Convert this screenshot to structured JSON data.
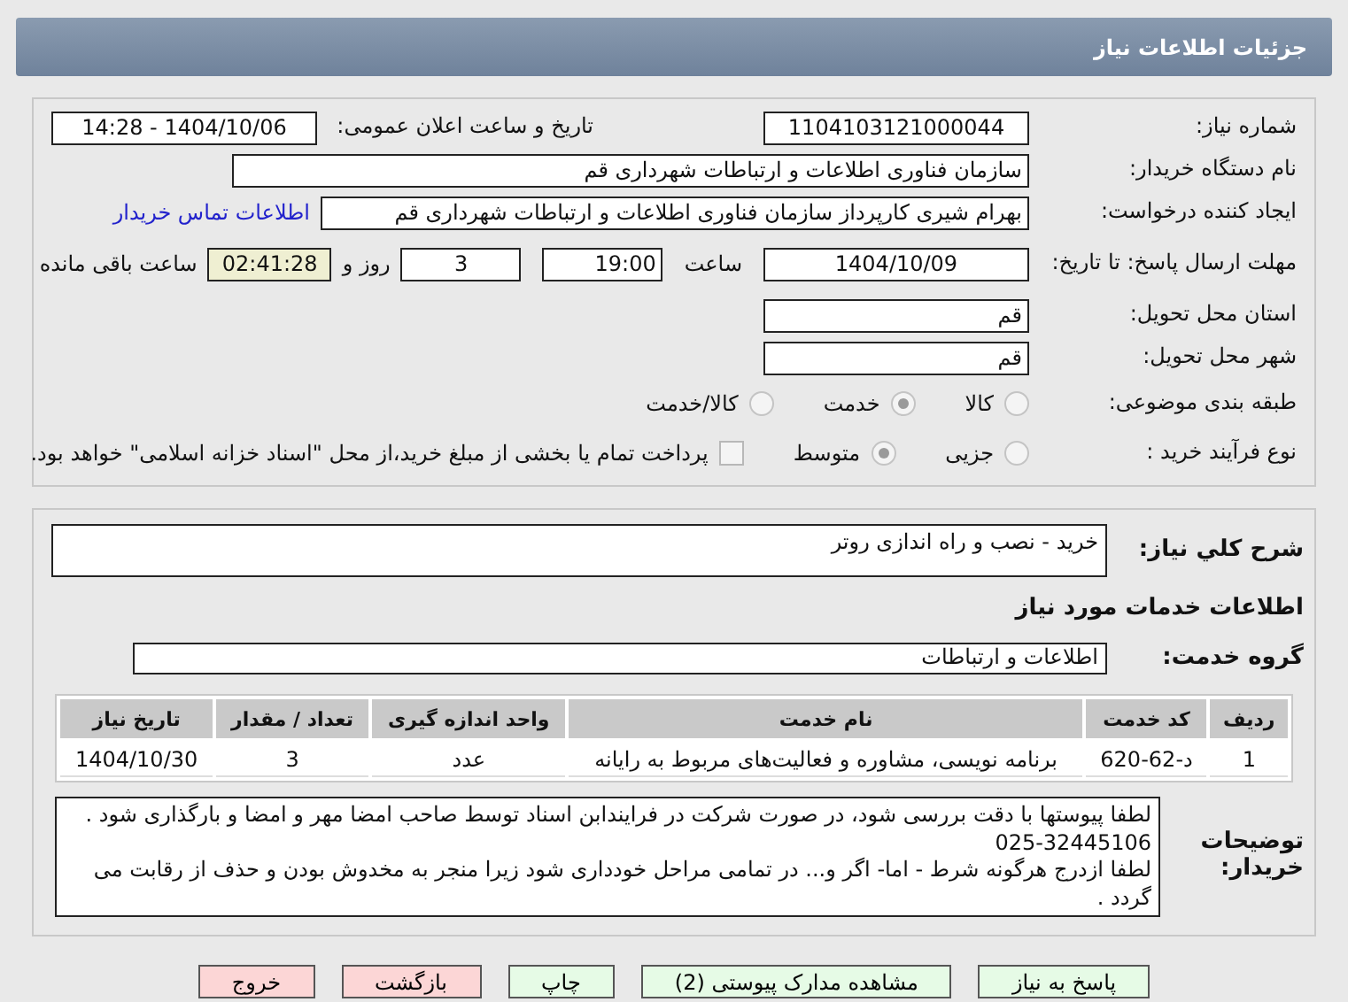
{
  "header": {
    "title": "جزئیات اطلاعات نیاز"
  },
  "need_number": {
    "label": "شماره نیاز:",
    "value": "1104103121000044"
  },
  "announce": {
    "label": "تاریخ و ساعت اعلان عمومی:",
    "value": "1404/10/06 - 14:28"
  },
  "buyer_org": {
    "label": "نام دستگاه خریدار:",
    "value": "سازمان فناوری اطلاعات و ارتباطات شهرداری قم"
  },
  "creator": {
    "label": "ایجاد کننده درخواست:",
    "value": "بهرام شیری کارپرداز سازمان فناوری اطلاعات و ارتباطات شهرداری قم",
    "link": "اطلاعات تماس خریدار"
  },
  "deadline": {
    "label": "مهلت ارسال پاسخ: تا تاریخ:",
    "date": "1404/10/09",
    "time_label": "ساعت",
    "time": "19:00",
    "days": "3",
    "days_label": "روز و",
    "remaining": "02:41:28",
    "remaining_label": "ساعت باقی مانده"
  },
  "province": {
    "label": "استان محل تحویل:",
    "value": "قم"
  },
  "city": {
    "label": "شهر محل تحویل:",
    "value": "قم"
  },
  "category": {
    "label": "طبقه بندی موضوعی:",
    "options": [
      {
        "label": "کالا",
        "selected": false
      },
      {
        "label": "خدمت",
        "selected": true
      },
      {
        "label": "کالا/خدمت",
        "selected": false
      }
    ]
  },
  "process": {
    "label": "نوع فرآیند خرید :",
    "options": [
      {
        "label": "جزیی",
        "selected": false
      },
      {
        "label": "متوسط",
        "selected": true
      }
    ],
    "checkbox": {
      "label": "پرداخت تمام یا بخشی از مبلغ خرید،از محل \"اسناد خزانه اسلامی\" خواهد بود.",
      "checked": false
    }
  },
  "description": {
    "label": "شرح کلي نياز:",
    "value": "خرید - نصب و راه اندازی روتر"
  },
  "services_title": "اطلاعات خدمات مورد نیاز",
  "service_group": {
    "label": "گروه خدمت:",
    "value": "اطلاعات و ارتباطات"
  },
  "table": {
    "columns": [
      "ردیف",
      "کد خدمت",
      "نام خدمت",
      "واحد اندازه گیری",
      "تعداد / مقدار",
      "تاریخ نیاز"
    ],
    "rows": [
      [
        "1",
        "د-62-620",
        "برنامه نویسی، مشاوره و فعالیت‌های مربوط به رایانه",
        "عدد",
        "3",
        "1404/10/30"
      ]
    ]
  },
  "buyer_notes": {
    "label": "توضیحات خریدار:",
    "lines": [
      "لطفا پیوستها با دقت بررسی شود، در صورت شرکت در فرایندابن اسناد توسط صاحب امضا مهر و امضا و بارگذاری شود .",
      "025-32445106",
      "لطفا ازدرج هرگونه شرط - اما- اگر و... در تمامی مراحل خودداری شود زیرا منجر به مخدوش بودن و حذف از رقابت می گردد ."
    ]
  },
  "buttons": [
    {
      "label": "پاسخ به نیاز",
      "kind": "normal"
    },
    {
      "label": "مشاهده مدارک پیوستی (2)",
      "kind": "normal"
    },
    {
      "label": "چاپ",
      "kind": "normal"
    },
    {
      "label": "بازگشت",
      "kind": "danger"
    },
    {
      "label": "خروج",
      "kind": "danger"
    }
  ]
}
